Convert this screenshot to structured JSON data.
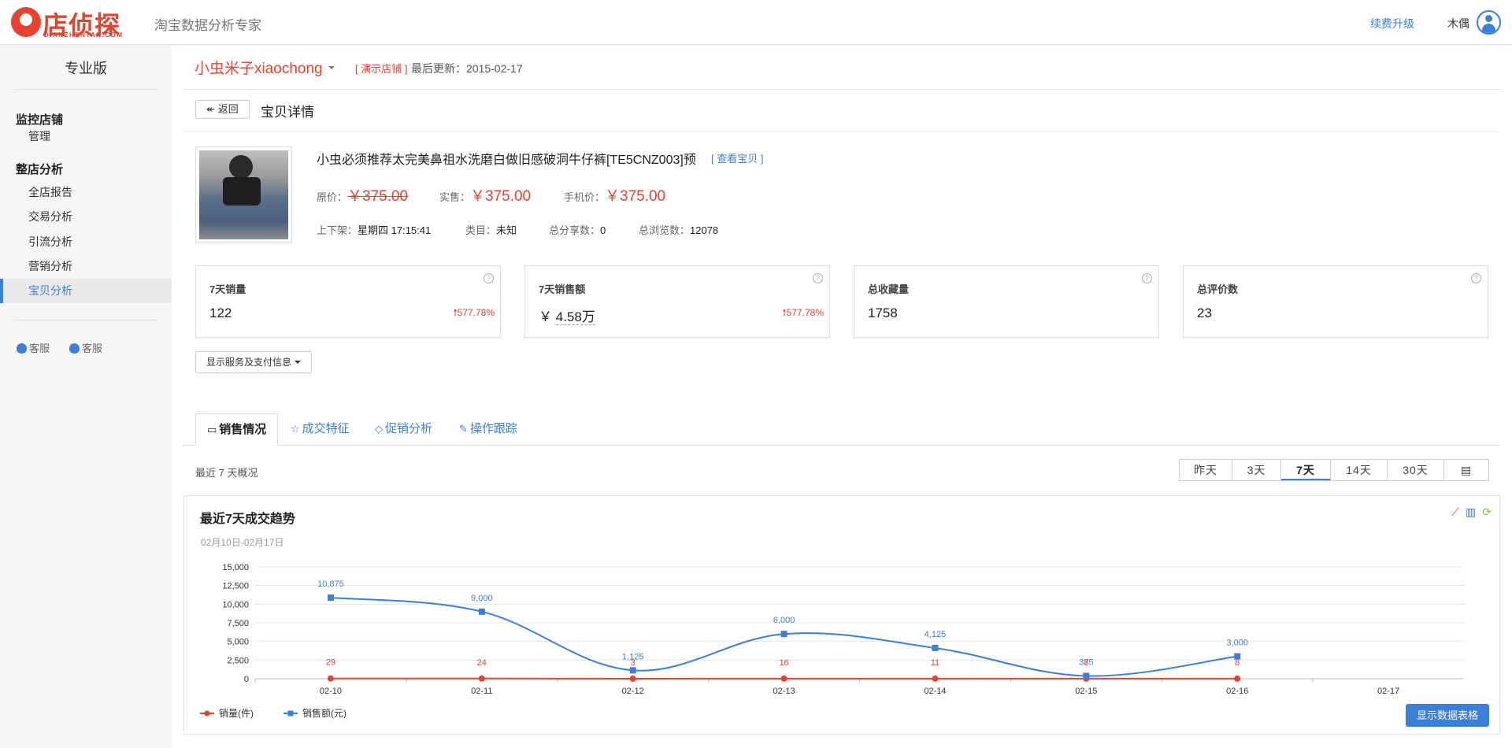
{
  "header": {
    "logo_text": "店侦探",
    "logo_sub": "DIANZHENTAN.COM",
    "slogan": "淘宝数据分析专家",
    "renew_label": "续费升级",
    "username": "木偶",
    "icons": [
      "logo-mark",
      "user-avatar-icon"
    ]
  },
  "sidebar": {
    "edition": "专业版",
    "groups": [
      {
        "title": "监控店铺",
        "items": [
          {
            "label": "管理"
          }
        ]
      },
      {
        "title": "整店分析",
        "items": [
          {
            "label": "全店报告"
          },
          {
            "label": "交易分析"
          },
          {
            "label": "引流分析"
          },
          {
            "label": "营销分析"
          },
          {
            "label": "宝贝分析",
            "active": true
          }
        ]
      }
    ],
    "services": [
      {
        "label": "客服",
        "icon": "qq-icon"
      },
      {
        "label": "客服",
        "icon": "wangwang-icon"
      }
    ]
  },
  "store": {
    "name": "小虫米子xiaochong",
    "demo_tag": "[ 演示店铺 ]",
    "last_update_label": "最后更新：",
    "last_update": "2015-02-17"
  },
  "page": {
    "back_label": "返回",
    "title": "宝贝详情"
  },
  "product": {
    "title": "小虫必须推荐太完美鼻祖水洗磨白做旧感破洞牛仔裤[TE5CNZ003]预",
    "view_link": "[ 查看宝贝 ]",
    "prices": {
      "orig_label": "原价：",
      "orig": "￥375.00",
      "real_label": "实售：",
      "real": "￥375.00",
      "mobile_label": "手机价：",
      "mobile": "￥375.00"
    },
    "meta": {
      "listing_label": "上下架：",
      "listing": "星期四 17:15:41",
      "category_label": "类目：",
      "category": "未知",
      "share_label": "总分享数：",
      "share": "0",
      "views_label": "总浏览数：",
      "views": "12078"
    }
  },
  "stats": [
    {
      "label": "7天销量",
      "value": "122",
      "trend": "577.78%"
    },
    {
      "label": "7天销售额",
      "value": "4.58万",
      "prefix": "￥",
      "trend": "577.78%"
    },
    {
      "label": "总收藏量",
      "value": "1758"
    },
    {
      "label": "总评价数",
      "value": "23"
    }
  ],
  "pay_info_label": "显示服务及支付信息",
  "tabs": [
    {
      "label": "销售情况",
      "icon": "chat-icon",
      "active": true
    },
    {
      "label": "成交特征",
      "icon": "star-icon"
    },
    {
      "label": "促销分析",
      "icon": "tag-icon"
    },
    {
      "label": "操作跟踪",
      "icon": "edit-icon"
    }
  ],
  "overview_label": "最近 7 天概况",
  "ranges": [
    "昨天",
    "3天",
    "7天",
    "14天",
    "30天"
  ],
  "range_selected": "7天",
  "chart_panel": {
    "title": "最近7天成交趋势",
    "subtitle": "02月10日-02月17日",
    "table_button": "显示数据表格",
    "accent": "#3c7fd9",
    "red": "#e8412f"
  },
  "chart_data": {
    "type": "line",
    "categories": [
      "02-10",
      "02-11",
      "02-12",
      "02-13",
      "02-14",
      "02-15",
      "02-16",
      "02-17"
    ],
    "series": [
      {
        "name": "销量(件)",
        "color": "#e8412f",
        "values": [
          29,
          24,
          3,
          16,
          11,
          8,
          8,
          null
        ],
        "labels": [
          "29",
          "24",
          "3",
          "16",
          "11",
          "8",
          "8"
        ]
      },
      {
        "name": "销售额(元)",
        "color": "#3c7fd9",
        "values": [
          10875,
          9000,
          1125,
          6000,
          4125,
          375,
          3000,
          null
        ],
        "labels": [
          "10,875",
          "9,000",
          "1,125",
          "6,000",
          "4,125",
          "375",
          "3,000"
        ]
      }
    ],
    "yticks": [
      "0",
      "2,500",
      "5,000",
      "7,500",
      "10,000",
      "12,500",
      "15,000"
    ],
    "ylim": [
      0,
      15000
    ],
    "grid": true,
    "legend": "bottom-left"
  }
}
